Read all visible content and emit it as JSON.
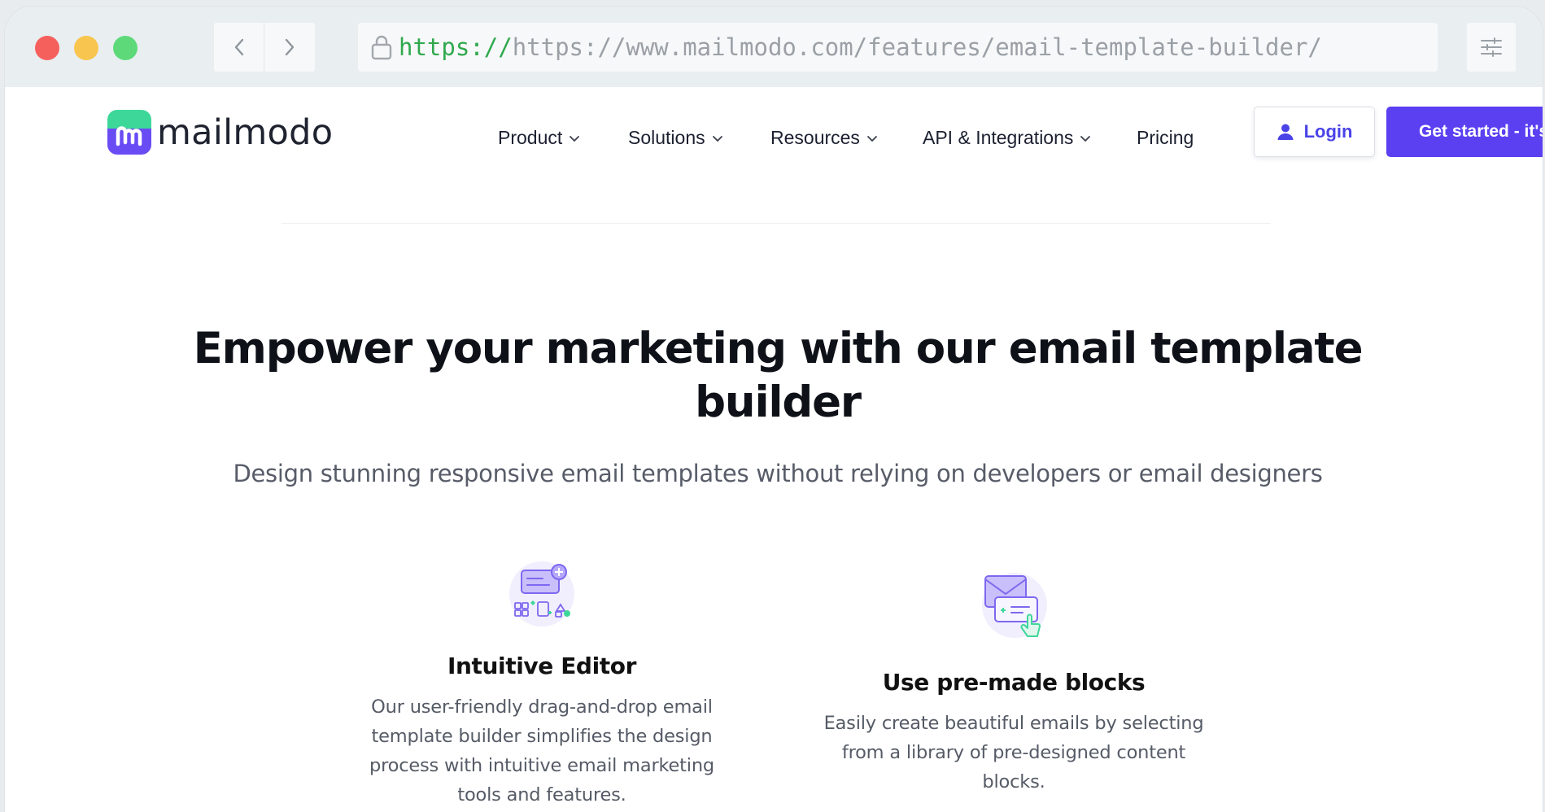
{
  "browser": {
    "url_scheme": "https://",
    "url_text": "https://www.mailmodo.com/features/email-template-builder/"
  },
  "brand": {
    "name": "mailmodo",
    "colors": {
      "primary": "#5b40f2",
      "logo_green": "#3ed79a",
      "logo_purple": "#6a4cf5"
    }
  },
  "nav": {
    "items": [
      {
        "label": "Product",
        "dropdown": true
      },
      {
        "label": "Solutions",
        "dropdown": true
      },
      {
        "label": "Resources",
        "dropdown": true
      },
      {
        "label": "API & Integrations",
        "dropdown": true
      },
      {
        "label": "Pricing",
        "dropdown": false
      }
    ],
    "login_label": "Login",
    "cta_label": "Get started - it's"
  },
  "hero": {
    "title": "Empower your marketing with our email template builder",
    "subtitle": "Design stunning responsive email templates without relying on developers or email designers"
  },
  "features": [
    {
      "icon": "editor-blocks-icon",
      "title": "Intuitive Editor",
      "description": "Our user-friendly drag-and-drop email template builder simplifies the design process with intuitive email marketing tools and features."
    },
    {
      "icon": "envelope-click-icon",
      "title": "Use pre-made blocks",
      "description": "Easily create beautiful emails by selecting from a library of pre-designed content blocks."
    }
  ]
}
